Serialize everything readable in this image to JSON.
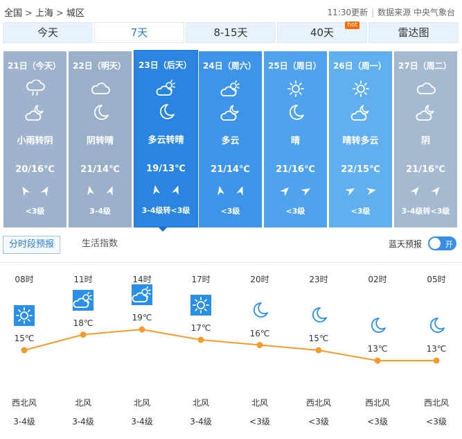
{
  "breadcrumb": [
    "全国",
    "上海",
    "城区"
  ],
  "breadcrumb_sep": ">",
  "meta": {
    "updated": "11:30更新",
    "source": "数据来源 中央气象台"
  },
  "tabs": [
    {
      "label": "今天",
      "active": false
    },
    {
      "label": "7天",
      "active": true
    },
    {
      "label": "8-15天",
      "active": false
    },
    {
      "label": "40天",
      "active": false,
      "badge": "hot"
    },
    {
      "label": "雷达图",
      "active": false
    }
  ],
  "days": [
    {
      "date": "21日（今天）",
      "icons": [
        "cloud-rain-icon",
        "cloud-moon-icon"
      ],
      "desc": "小雨转阴",
      "temp": "20/16℃",
      "wind": "<3级",
      "color": "#9fb4cc"
    },
    {
      "date": "22日（明天）",
      "icons": [
        "cloud-icon",
        "moon-icon"
      ],
      "desc": "阴转晴",
      "temp": "21/14℃",
      "wind": "3-4级",
      "color": "#9ab0c9"
    },
    {
      "date": "23日（后天）",
      "icons": [
        "cloud-sun-icon",
        "moon-icon"
      ],
      "desc": "多云转晴",
      "temp": "19/13℃",
      "wind": "3-4级转<3级",
      "color": "#2a85e1",
      "selected": true
    },
    {
      "date": "24日（周六）",
      "icons": [
        "cloud-sun-icon",
        "cloud-moon-icon"
      ],
      "desc": "多云",
      "temp": "21/14℃",
      "wind": "<3级",
      "color": "#3d94e8"
    },
    {
      "date": "25日（周日）",
      "icons": [
        "sun-icon",
        "moon-icon"
      ],
      "desc": "晴",
      "temp": "21/16℃",
      "wind": "<3级",
      "color": "#4fa2ec"
    },
    {
      "date": "26日（周一）",
      "icons": [
        "sun-icon",
        "cloud-moon-icon"
      ],
      "desc": "晴转多云",
      "temp": "22/15℃",
      "wind": "<3级",
      "color": "#62aff0"
    },
    {
      "date": "27日（周二）",
      "icons": [
        "cloud-icon",
        "cloud-moon-icon"
      ],
      "desc": "阴",
      "temp": "21/16℃",
      "wind": "3-4级转<3级",
      "color": "#a5bad0"
    }
  ],
  "subtabs": {
    "hourly": "分时段预报",
    "life": "生活指数"
  },
  "blue_sky": {
    "label": "蓝天预报",
    "toggle": "开"
  },
  "hourly": [
    {
      "time": "08时",
      "icon": "sun-icon",
      "temp": 15,
      "temp_label": "15℃",
      "wind_dir": "西北风",
      "wind_level": "3-4级"
    },
    {
      "time": "11时",
      "icon": "cloud-sun-icon",
      "temp": 18,
      "temp_label": "18℃",
      "wind_dir": "北风",
      "wind_level": "3-4级"
    },
    {
      "time": "14时",
      "icon": "cloud-sun-icon",
      "temp": 19,
      "temp_label": "19℃",
      "wind_dir": "北风",
      "wind_level": "3-4级"
    },
    {
      "time": "17时",
      "icon": "sun-icon",
      "temp": 17,
      "temp_label": "17℃",
      "wind_dir": "北风",
      "wind_level": "3-4级"
    },
    {
      "time": "20时",
      "icon": "moon-icon",
      "temp": 16,
      "temp_label": "16℃",
      "wind_dir": "北风",
      "wind_level": "<3级"
    },
    {
      "time": "23时",
      "icon": "moon-icon",
      "temp": 15,
      "temp_label": "15℃",
      "wind_dir": "西北风",
      "wind_level": "<3级"
    },
    {
      "time": "02时",
      "icon": "moon-icon",
      "temp": 13,
      "temp_label": "13℃",
      "wind_dir": "西北风",
      "wind_level": "<3级"
    },
    {
      "time": "05时",
      "icon": "moon-icon",
      "temp": 13,
      "temp_label": "13℃",
      "wind_dir": "西北风",
      "wind_level": "<3级"
    }
  ],
  "colors": {
    "accent": "#2a7bd1",
    "line": "#f59b2e",
    "icon_bg": "#2a8fe6"
  }
}
